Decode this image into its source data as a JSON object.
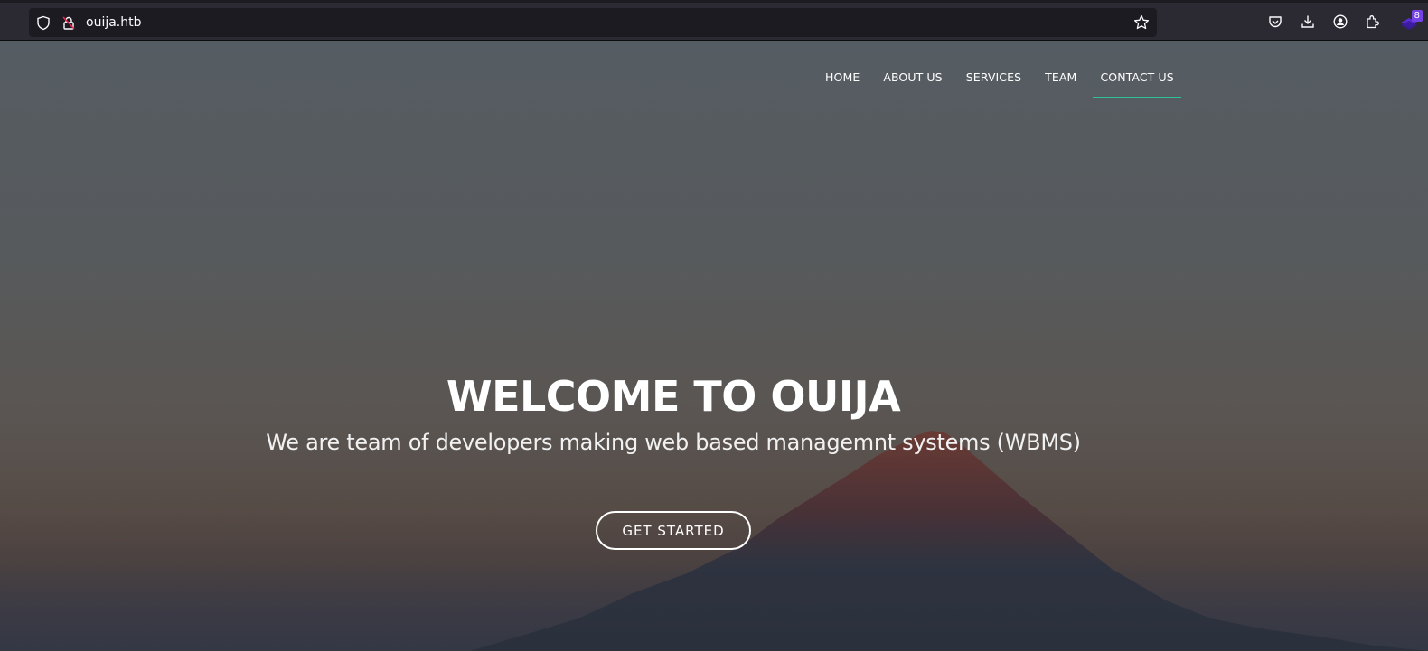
{
  "browser": {
    "url": "ouija.htb",
    "icons": {
      "tracking": "shield-icon",
      "security": "insecure-lock-icon",
      "bookmark": "star-icon",
      "pocket": "pocket-icon",
      "downloads": "download-icon",
      "account": "account-icon",
      "extensions": "puzzle-icon",
      "extension_badge": "extension-stack-icon"
    },
    "extension_badge_count": "8"
  },
  "nav": {
    "items": [
      {
        "label": "HOME",
        "active": false
      },
      {
        "label": "ABOUT US",
        "active": false
      },
      {
        "label": "SERVICES",
        "active": false
      },
      {
        "label": "TEAM",
        "active": false
      },
      {
        "label": "CONTACT US",
        "active": true
      }
    ],
    "active_color": "#2bc29a"
  },
  "hero": {
    "title": "WELCOME TO OUIJA",
    "subtitle": "We are team of developers making web based managemnt systems (WBMS)",
    "cta_label": "GET STARTED"
  }
}
